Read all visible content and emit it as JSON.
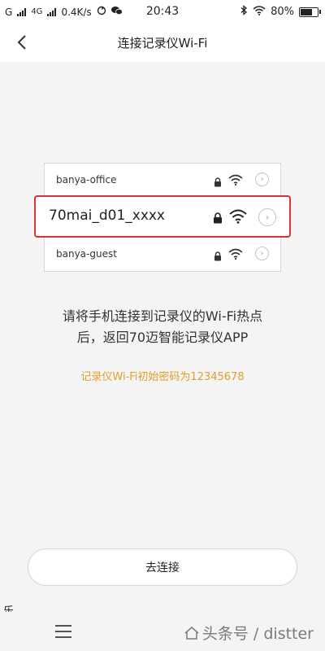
{
  "status_bar": {
    "carrier_g": "G",
    "carrier_4g": "4G",
    "speed": "0.4K/s",
    "time": "20:43",
    "battery": "80%",
    "battery_level": 0.8
  },
  "header": {
    "title": "连接记录仪Wi-Fi"
  },
  "wifi_list": [
    {
      "name": "banya-office"
    },
    {
      "name": "70mai_d01_xxxx"
    },
    {
      "name": "banya-guest"
    }
  ],
  "instruction": {
    "line1": "请将手机连接到记录仪的Wi-Fi热点",
    "line2": "后，返回70迈智能记录仪APP"
  },
  "password_hint": "记录仪Wi-Fi初始密码为12345678",
  "connect_button": "去连接",
  "side_mark": "乐",
  "watermark": "头条号 / distter"
}
